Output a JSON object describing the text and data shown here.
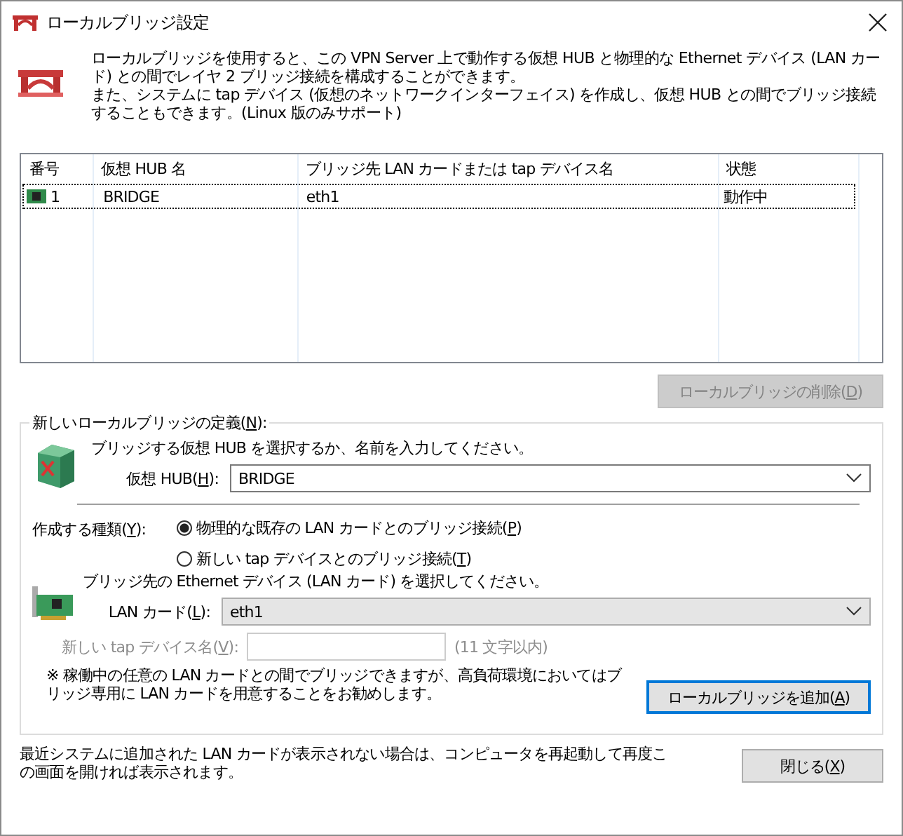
{
  "window": {
    "title": "ローカルブリッジ設定"
  },
  "description": [
    "ローカルブリッジを使用すると、この VPN Server 上で動作する仮想 HUB と物理的な Ethernet デバイス (LAN カード) との間でレイヤ 2 ブリッジ接続を構成することができます。",
    "また、システムに tap デバイス (仮想のネットワークインターフェイス) を作成し、仮想 HUB との間でブリッジ接続することもできます。(Linux 版のみサポート)"
  ],
  "table": {
    "columns": [
      "番号",
      "仮想 HUB 名",
      "ブリッジ先 LAN カードまたは tap デバイス名",
      "状態"
    ],
    "rows": [
      {
        "cells": [
          "1",
          "BRIDGE",
          "eth1",
          "動作中"
        ],
        "focused": true
      }
    ]
  },
  "delete_button": {
    "pre": "ローカルブリッジの削除(",
    "key": "D",
    "post": ")",
    "disabled": true
  },
  "group": {
    "pre": "新しいローカルブリッジの定義(",
    "key": "N",
    "post": "):"
  },
  "hub_prompt": "ブリッジする仮想 HUB を選択するか、名前を入力してください。",
  "hub_field": {
    "pre": "仮想 HUB(",
    "key": "H",
    "post": "):",
    "value": "BRIDGE"
  },
  "type_label": {
    "pre": "作成する種類(",
    "key": "Y",
    "post": "):"
  },
  "radios": [
    {
      "pre": "物理的な既存の LAN カードとのブリッジ接続(",
      "key": "P",
      "post": ")",
      "selected": true
    },
    {
      "pre": "新しい tap デバイスとのブリッジ接続(",
      "key": "T",
      "post": ")",
      "selected": false
    }
  ],
  "card_prompt": "ブリッジ先の Ethernet デバイス (LAN カード) を選択してください。",
  "lan_card": {
    "pre": "LAN カード(",
    "key": "L",
    "post": "):",
    "value": "eth1"
  },
  "tap_name": {
    "pre": "新しい tap デバイス名(",
    "key": "V",
    "post": "):",
    "hint": "(11 文字以内)",
    "disabled": true
  },
  "note": "※ 稼働中の任意の LAN カードとの間でブリッジできますが、高負荷環境においてはブリッジ専用に LAN カードを用意することをお勧めします。",
  "add_button": {
    "pre": "ローカルブリッジを追加(",
    "key": "A",
    "post": ")",
    "default": true
  },
  "footer_note": "最近システムに追加された LAN カードが表示されない場合は、コンピュータを再起動して再度この画面を開ければ表示されます。",
  "close_button": {
    "pre": "閉じる(",
    "key": "X",
    "post": ")"
  }
}
